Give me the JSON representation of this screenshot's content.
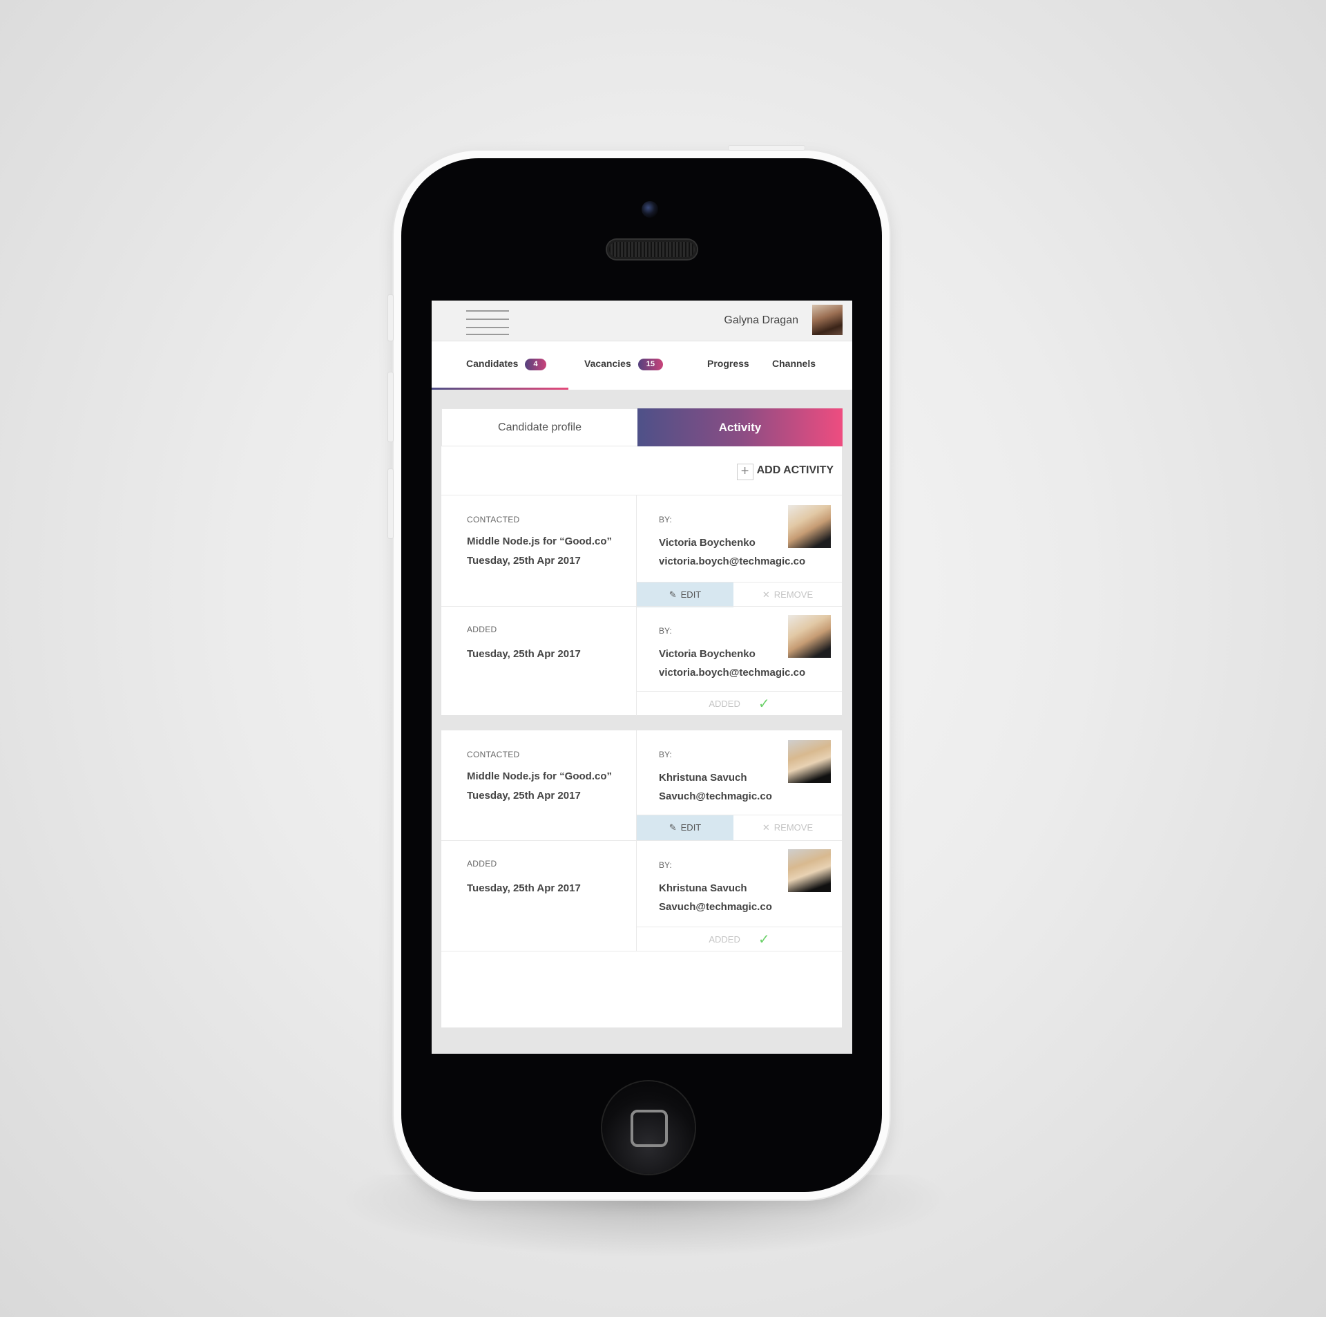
{
  "header": {
    "user_name": "Galyna Dragan"
  },
  "nav_tabs": [
    {
      "label": "Candidates",
      "badge": "4"
    },
    {
      "label": "Vacancies",
      "badge": "15"
    },
    {
      "label": "Progress"
    },
    {
      "label": "Channels"
    }
  ],
  "segment": {
    "profile_label": "Candidate profile",
    "activity_label": "Activity"
  },
  "add_activity_label": "ADD ACTIVITY",
  "icons": {
    "plus": "+",
    "edit": "✎",
    "remove": "✕",
    "check": "✓"
  },
  "labels": {
    "by": "BY:",
    "edit": "EDIT",
    "remove": "REMOVE",
    "added": "ADDED"
  },
  "groups": [
    {
      "entries": [
        {
          "type": "CONTACTED",
          "title": "Middle Node.js for “Good.co”",
          "date": "Tuesday, 25th Apr 2017",
          "person": "Victoria Boychenko",
          "email": "victoria.boych@techmagic.co"
        },
        {
          "type": "ADDED",
          "date": "Tuesday, 25th Apr 2017",
          "person": "Victoria Boychenko",
          "email": "victoria.boych@techmagic.co"
        }
      ]
    },
    {
      "entries": [
        {
          "type": "CONTACTED",
          "title": "Middle Node.js for “Good.co”",
          "date": "Tuesday, 25th Apr 2017",
          "person": "Khristuna Savuch",
          "email": "Savuch@techmagic.co"
        },
        {
          "type": "ADDED",
          "date": "Tuesday, 25th Apr 2017",
          "person": "Khristuna Savuch",
          "email": "Savuch@techmagic.co"
        }
      ]
    }
  ],
  "colors": {
    "accent_start": "#4e5188",
    "accent_end": "#ee4d80",
    "edit_bg": "#d7e7f0",
    "check": "#6cd16a"
  }
}
